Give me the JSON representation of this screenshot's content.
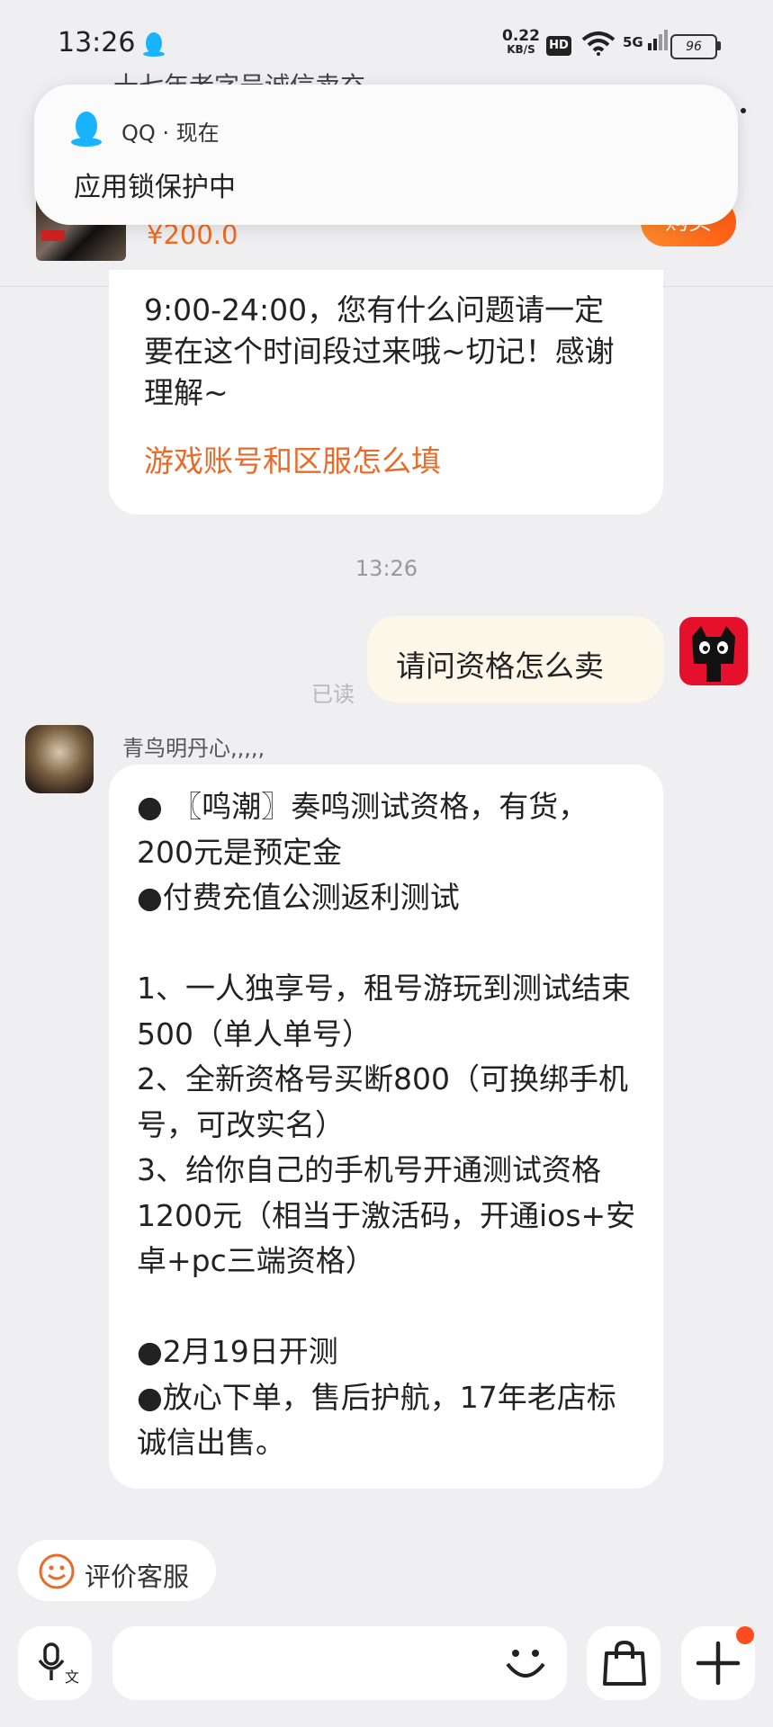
{
  "status_bar": {
    "time": "13:26",
    "net_speed_value": "0.22",
    "net_speed_unit": "KB/S",
    "hd": "HD",
    "network": "5G",
    "battery": "96"
  },
  "product": {
    "title": "十七年老字号诚信卖充",
    "price": "¥200.0",
    "buy_label": "购买"
  },
  "notification": {
    "app": "QQ · 现在",
    "body": "应用锁保护中"
  },
  "chat": {
    "bubble1_text": "9:00-24:00，您有什么问题请一定要在这个时间段过来哦~切记！感谢理解~",
    "faq_link": "游戏账号和区服怎么填",
    "time": "13:26",
    "my_message": "请问资格怎么卖",
    "read_receipt": "已读",
    "agent_name": "青鸟明丹心,,,,,",
    "agent_message": "● 〖鸣潮〗奏鸣测试资格，有货，200元是预定金\n●付费充值公测返利测试\n\n1、一人独享号，租号游玩到测试结束500（单人单号）\n2、全新资格号买断800（可换绑手机号，可改实名）\n3、给你自己的手机号开通测试资格1200元（相当于激活码，开通ios+安卓+pc三端资格）\n\n●2月19日开测\n●放心下单，售后护航，17年老店标诚信出售。"
  },
  "footer": {
    "evaluate_label": "评价客服"
  },
  "icons": {
    "qq": "qq-penguin-icon",
    "wifi": "wifi-icon",
    "smiley": "smiley-icon",
    "voice": "voice-translate-icon",
    "emoji": "emoji-icon",
    "shop": "shopping-bag-icon",
    "plus": "plus-icon"
  },
  "colors": {
    "accent_orange": "#e86b2a",
    "qq_blue": "#18b4ff",
    "badge": "#ff4d1f"
  }
}
